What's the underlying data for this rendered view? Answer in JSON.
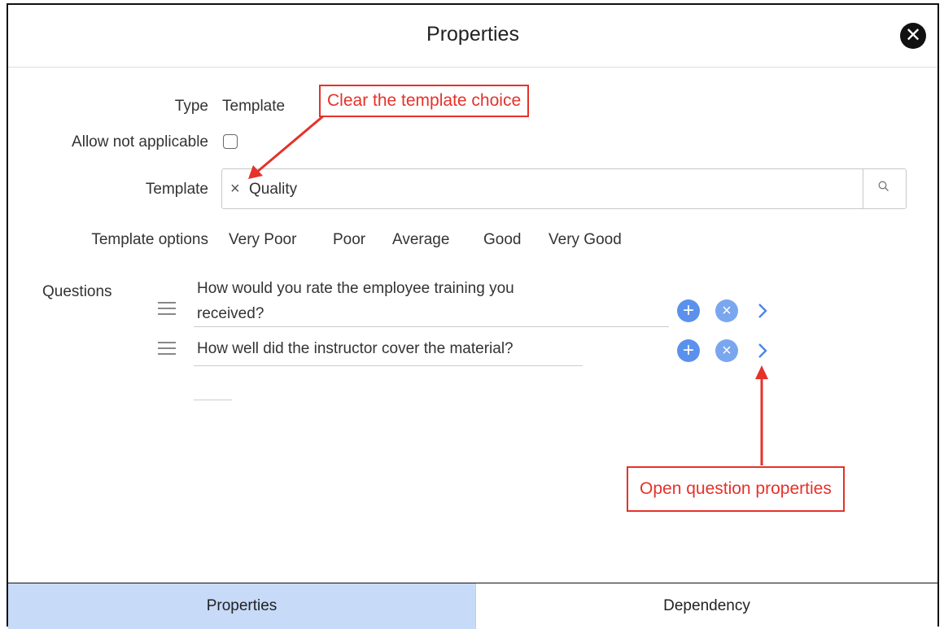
{
  "dialog": {
    "title": "Properties",
    "close_symbol": "✕"
  },
  "form": {
    "type_label": "Type",
    "type_value": "Template",
    "allow_na_label": "Allow not applicable",
    "allow_na_checked": false,
    "template_label": "Template",
    "template_clear_symbol": "×",
    "template_value": "Quality",
    "template_options_label": "Template options",
    "template_options": [
      "Very Poor",
      "Poor",
      "Average",
      "Good",
      "Very Good"
    ],
    "questions_label": "Questions",
    "questions": [
      {
        "line1": "How would you rate the employee training you",
        "line2": "received?"
      },
      {
        "line1": "How well did the instructor cover the material?"
      }
    ]
  },
  "annotations": {
    "clear_template": "Clear the template choice",
    "open_question": "Open question properties",
    "color": "#e5322a"
  },
  "footer": {
    "tabs": [
      {
        "label": "Properties",
        "active": true
      },
      {
        "label": "Dependency",
        "active": false
      }
    ]
  },
  "colors": {
    "accent_blue": "#5b91ec",
    "active_tab": "#c7daf8"
  }
}
